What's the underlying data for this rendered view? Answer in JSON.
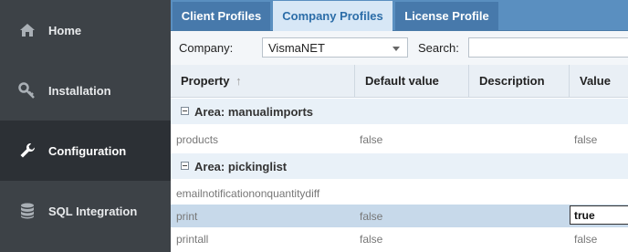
{
  "sidebar": {
    "items": [
      {
        "label": "Home",
        "icon": "home-icon",
        "active": false
      },
      {
        "label": "Installation",
        "icon": "key-icon",
        "active": false
      },
      {
        "label": "Configuration",
        "icon": "wrench-icon",
        "active": true
      },
      {
        "label": "SQL Integration",
        "icon": "database-icon",
        "active": false
      }
    ]
  },
  "tabs": [
    {
      "label": "Client Profiles",
      "active": false
    },
    {
      "label": "Company Profiles",
      "active": true
    },
    {
      "label": "License Profile",
      "active": false
    }
  ],
  "toolbar": {
    "company_label": "Company:",
    "company_value": "VismaNET",
    "search_label": "Search:",
    "search_value": ""
  },
  "grid": {
    "columns": [
      "Property",
      "Default value",
      "Description",
      "Value"
    ],
    "sort_indicator": "↑",
    "groups": [
      {
        "label": "Area: manualimports",
        "rows": [
          {
            "property": "products",
            "default": "false",
            "description": "",
            "value": "false",
            "selected": false
          }
        ]
      },
      {
        "label": "Area: pickinglist",
        "rows": [
          {
            "property": "emailnotificationonquantitydiff",
            "default": "",
            "description": "",
            "value": "",
            "selected": false
          },
          {
            "property": "print",
            "default": "false",
            "description": "",
            "value": "true",
            "selected": true
          },
          {
            "property": "printall",
            "default": "false",
            "description": "",
            "value": "false",
            "selected": false
          }
        ]
      }
    ]
  },
  "colors": {
    "sidebar_bg": "#3d4247",
    "sidebar_active": "#2c3035",
    "tab_bar": "#5a8fc0",
    "tab_active": "#d7e7f6",
    "header_bg": "#e9eff5",
    "group_bg": "#e9f1f8",
    "selected_row": "#c7d9ea"
  }
}
